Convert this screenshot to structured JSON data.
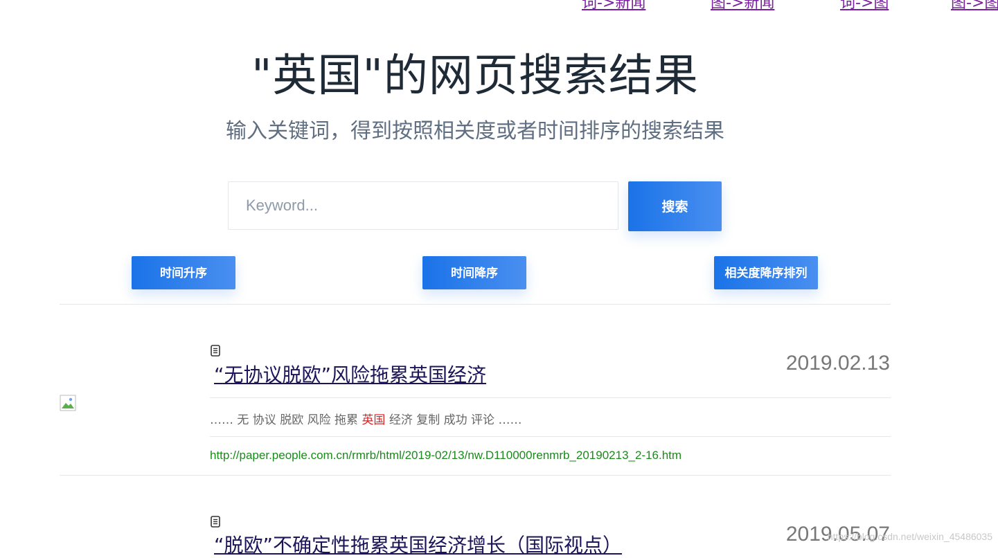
{
  "top_nav": [
    {
      "label": "词->新闻"
    },
    {
      "label": "图->新闻"
    },
    {
      "label": "词->图"
    },
    {
      "label": "图->图"
    }
  ],
  "heading": {
    "title": "\"英国\"的网页搜索结果",
    "subtitle": "输入关键词，得到按照相关度或者时间排序的搜索结果"
  },
  "search": {
    "placeholder": "Keyword...",
    "button_label": "搜索"
  },
  "sort_buttons": [
    {
      "label": "时间升序"
    },
    {
      "label": "时间降序"
    },
    {
      "label": "相关度降序排列"
    }
  ],
  "results": [
    {
      "title": "“无协议脱欧”风险拖累英国经济",
      "date": "2019.02.13",
      "snippet_before": "…… 无 协议 脱欧 风险 拖累 ",
      "snippet_highlight": "英国",
      "snippet_after": " 经济 复制 成功 评论 ……",
      "url": "http://paper.people.com.cn/rmrb/html/2019-02/13/nw.D110000renmrb_20190213_2-16.htm"
    },
    {
      "title": "“脱欧”不确定性拖累英国经济增长（国际视点）",
      "date": "2019.05.07"
    }
  ],
  "watermark": "https://blog.csdn.net/weixin_45486035",
  "colors": {
    "accent": "#1a73e8",
    "link_visited": "#7a1fa0",
    "title_link": "#1c1559",
    "url_green": "#1a8a1a",
    "highlight": "#e02020"
  }
}
